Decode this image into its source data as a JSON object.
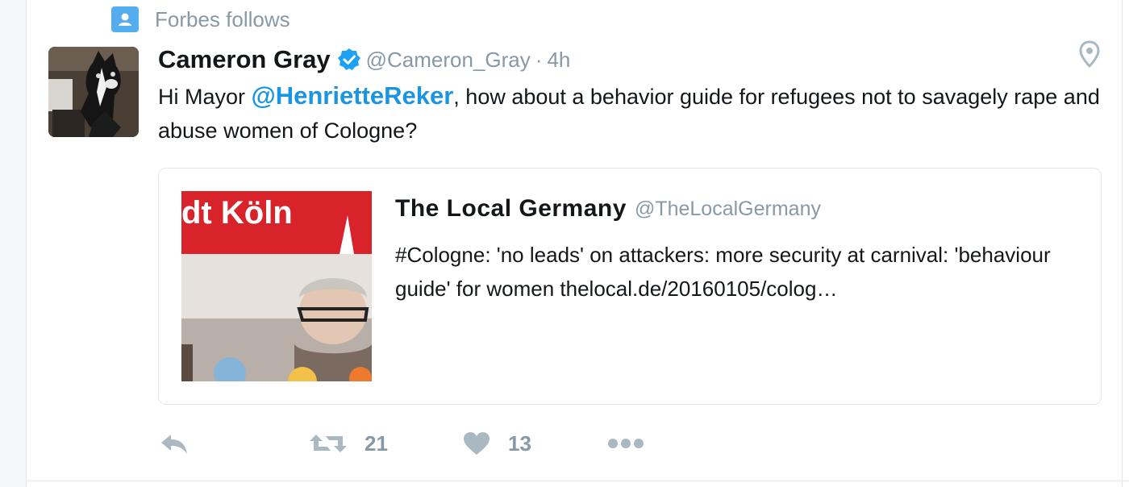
{
  "context": {
    "label": "Forbes follows",
    "icon": "person-icon"
  },
  "tweet": {
    "author_name": "Cameron Gray",
    "author_handle": "@Cameron_Gray",
    "separator": "·",
    "time": "4h",
    "text_before": "Hi Mayor ",
    "mention": "@HenrietteReker",
    "text_after": ", how about a behavior guide for refugees not to savagely rape and abuse women of Cologne?"
  },
  "quoted": {
    "name": "The Local Germany",
    "handle": "@TheLocalGermany",
    "text": "#Cologne: 'no leads' on attackers: more security at carnival: 'behaviour guide' for women thelocal.de/20160105/colog…",
    "image_banner_text": "dt Köln"
  },
  "actions": {
    "retweet_count": "21",
    "like_count": "13"
  },
  "colors": {
    "accent": "#1b95e0",
    "muted": "#8899a6",
    "context_icon": "#55acee"
  }
}
